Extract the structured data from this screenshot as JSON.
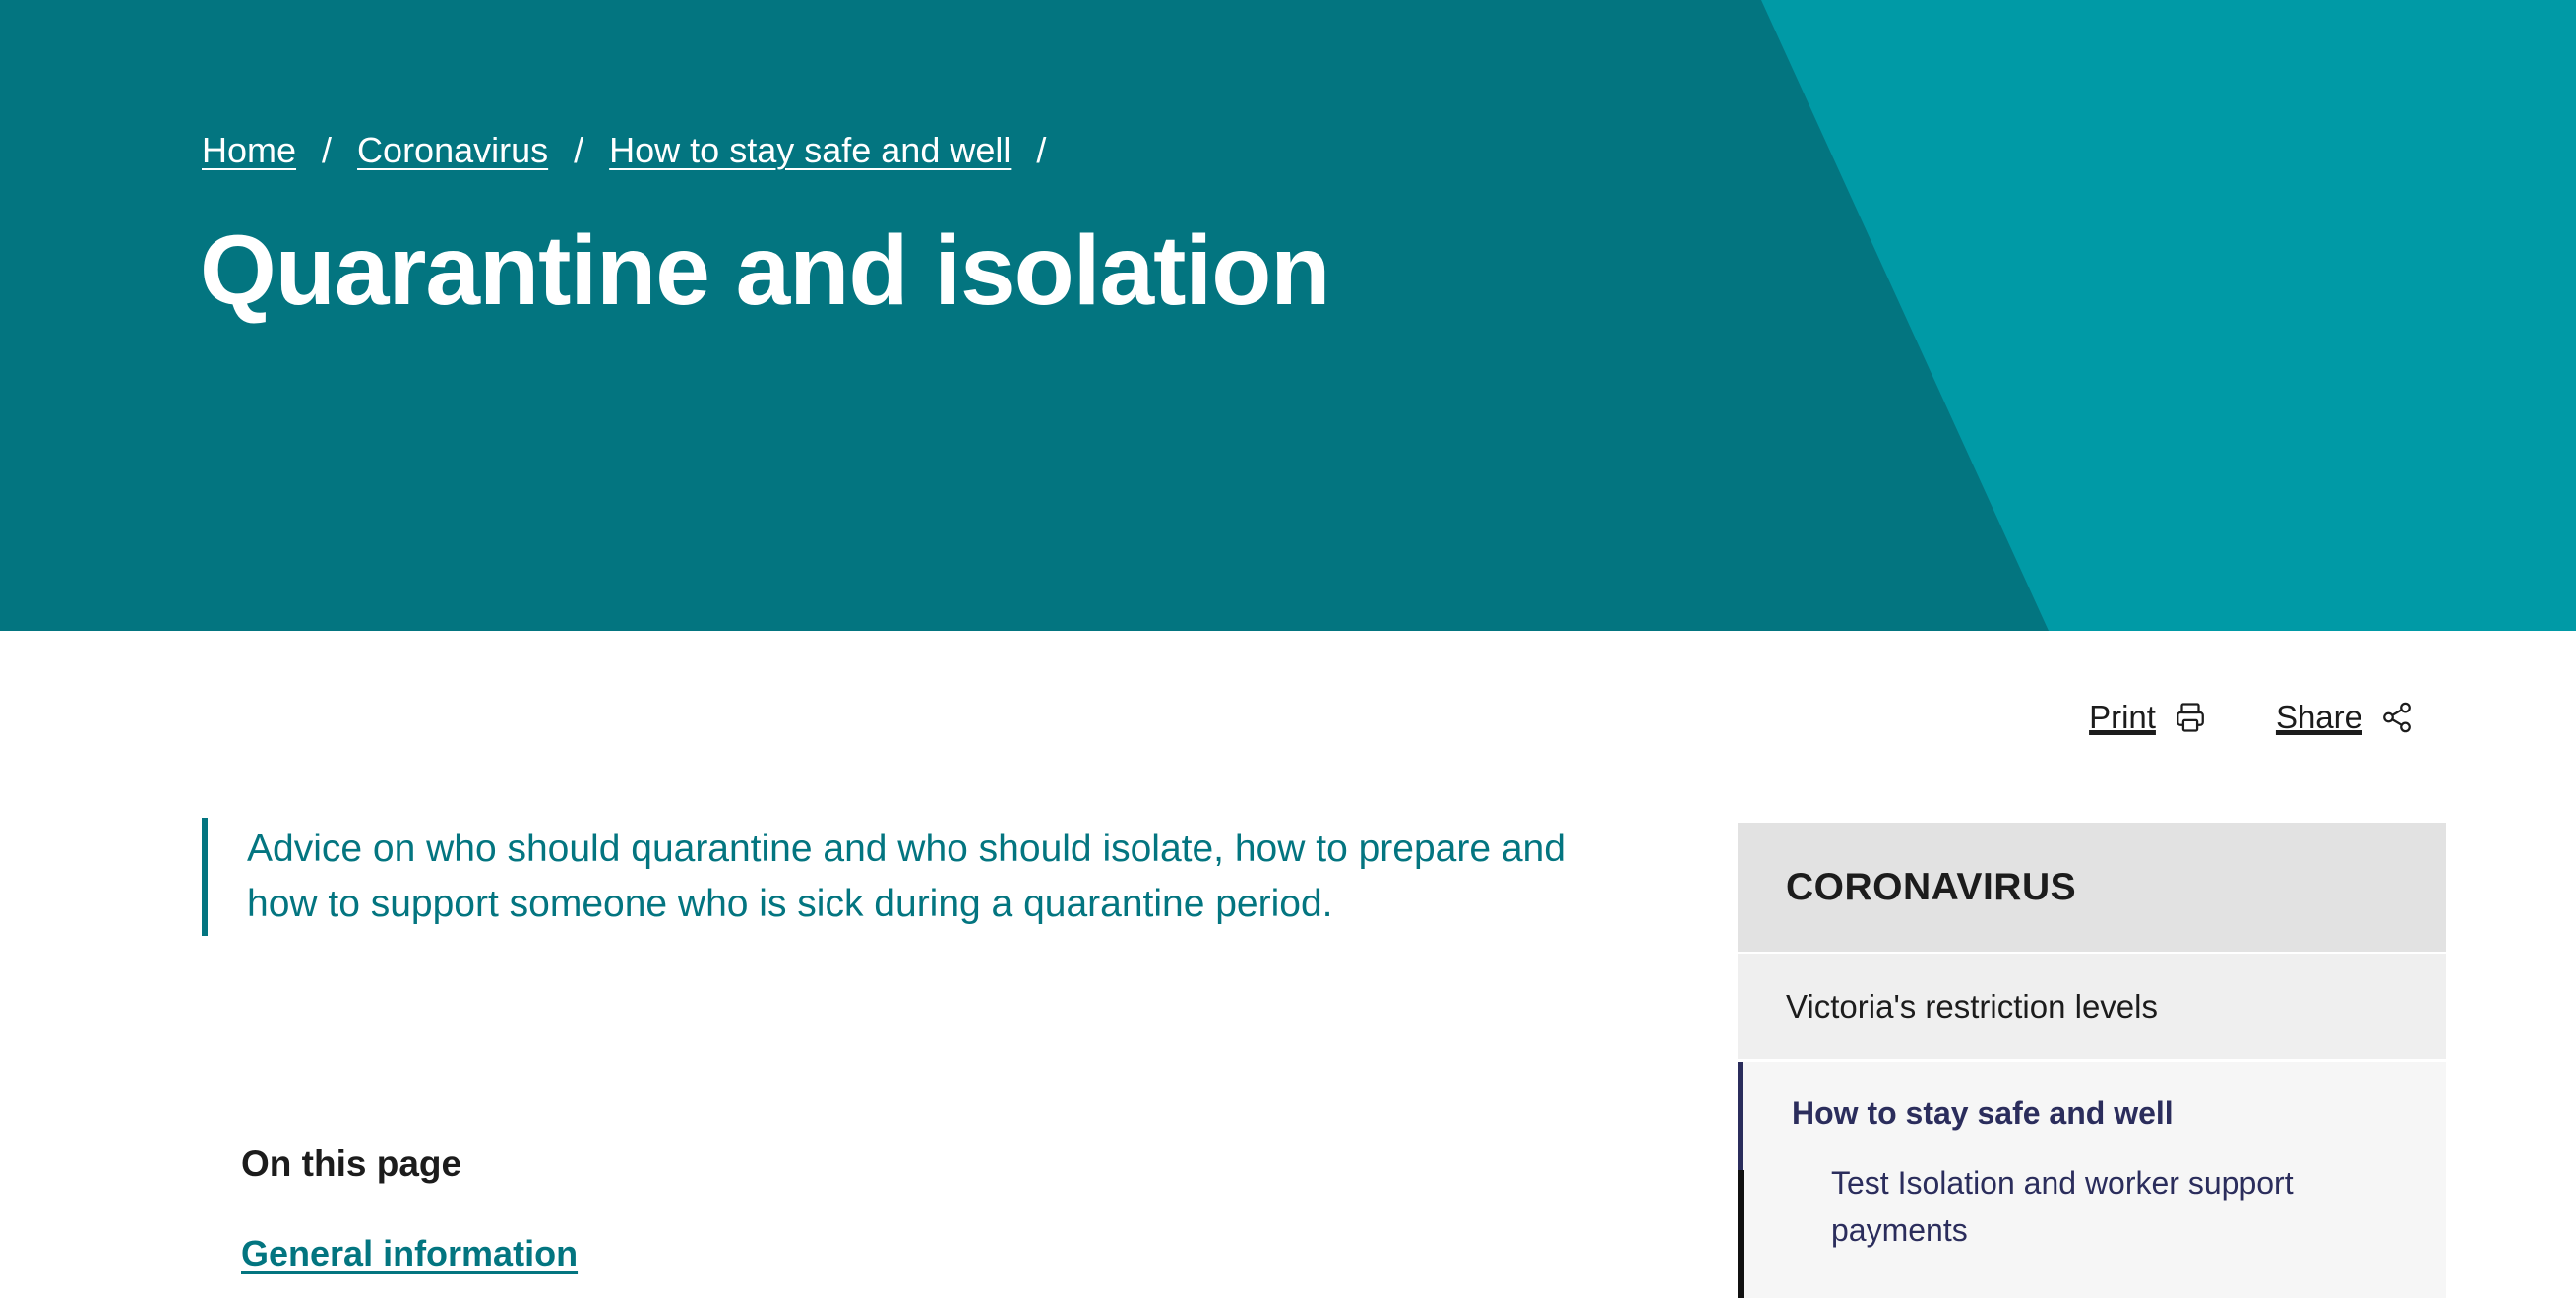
{
  "breadcrumb": {
    "items": [
      "Home",
      "Coronavirus",
      "How to stay safe and well"
    ],
    "separator": "/"
  },
  "page_title": "Quarantine and isolation",
  "actions": {
    "print_label": "Print",
    "share_label": "Share",
    "print_icon": "printer-icon",
    "share_icon": "share-icon"
  },
  "intro": "Advice on who should quarantine and who should isolate, how to prepare and how to support someone who is sick during a quarantine period.",
  "on_this_page": {
    "heading": "On this page",
    "links": [
      "General information"
    ]
  },
  "sidebar": {
    "heading": "CORONAVIRUS",
    "items": [
      "Victoria's restriction levels"
    ],
    "active_item": "How to stay safe and well",
    "sub_items": [
      "Test Isolation and worker support payments"
    ]
  },
  "colors": {
    "hero_dark": "#037580",
    "hero_light": "#009aa6",
    "accent": "#037580",
    "nav_active": "#2b2d5c"
  }
}
